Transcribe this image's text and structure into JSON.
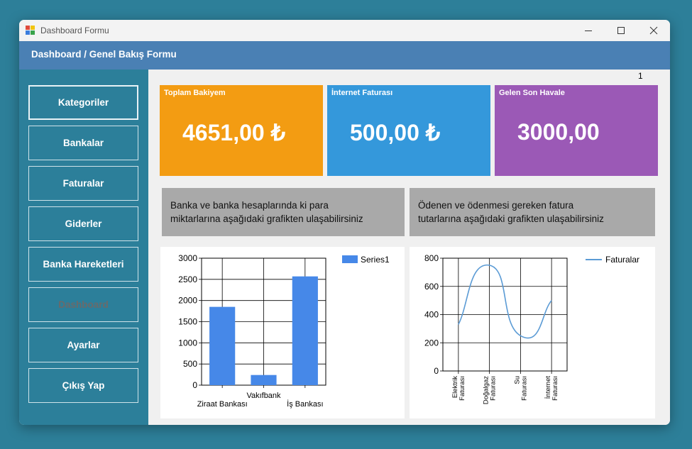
{
  "window": {
    "title": "Dashboard Formu",
    "header_title": "Dashboard / Genel Bakış Formu"
  },
  "sidebar": {
    "items": [
      {
        "label": "Kategoriler",
        "state": "active"
      },
      {
        "label": "Bankalar",
        "state": "normal"
      },
      {
        "label": "Faturalar",
        "state": "normal"
      },
      {
        "label": "Giderler",
        "state": "normal"
      },
      {
        "label": "Banka Hareketleri",
        "state": "normal"
      },
      {
        "label": "Dashboard",
        "state": "disabled"
      },
      {
        "label": "Ayarlar",
        "state": "normal"
      },
      {
        "label": "Çıkış Yap",
        "state": "normal"
      }
    ]
  },
  "counter": "1",
  "cards": [
    {
      "title": "Toplam Bakiyem",
      "value": "4651,00 ₺",
      "color": "#f39c12"
    },
    {
      "title": "İnternet Faturası",
      "value": "500,00 ₺",
      "color": "#3498db"
    },
    {
      "title": "Gelen Son Havale",
      "value": "3000,00",
      "color": "#9b59b6"
    }
  ],
  "info": {
    "left_line1": "Banka ve banka hesaplarında ki para",
    "left_line2": "miktarlarına aşağıdaki grafikten ulaşabilirsiniz",
    "right_line1": "Ödenen ve ödenmesi gereken fatura",
    "right_line2": "tutarlarına aşağıdaki grafikten ulaşabilirsiniz"
  },
  "colors": {
    "bar": "#4688e8",
    "line": "#5b9bd5",
    "sidebar": "#2c7f9a",
    "header": "#4a80b4"
  },
  "chart_data": [
    {
      "type": "bar",
      "categories": [
        "Ziraat Bankası",
        "Vakıfbank",
        "İş Bankası"
      ],
      "series": [
        {
          "name": "Series1",
          "values": [
            1850,
            240,
            2570
          ]
        }
      ],
      "ylim": [
        0,
        3000
      ],
      "yticks": [
        "0",
        "500",
        "1000",
        "1500",
        "2000",
        "2500",
        "3000"
      ],
      "grid": true,
      "legend": "top-right"
    },
    {
      "type": "line",
      "categories": [
        "Elektrik Faturası",
        "Doğalgaz Faturası",
        "Su Faturası",
        "İnternet Faturası"
      ],
      "series": [
        {
          "name": "Faturalar",
          "values": [
            330,
            750,
            250,
            500
          ]
        }
      ],
      "ylim": [
        0,
        800
      ],
      "yticks": [
        "0",
        "200",
        "400",
        "600",
        "800"
      ],
      "grid": true,
      "legend": "top-right"
    }
  ]
}
